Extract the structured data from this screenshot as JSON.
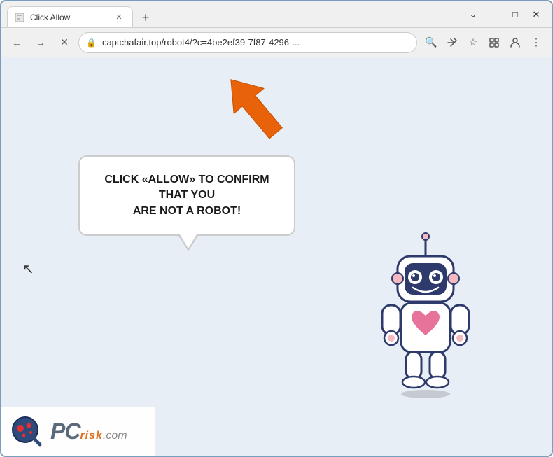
{
  "window": {
    "title": "Click Allow",
    "controls": {
      "minimize": "—",
      "maximize": "□",
      "close": "✕",
      "expand": "⌄"
    }
  },
  "tab": {
    "title": "Click Allow",
    "close_label": "✕",
    "new_tab_label": "+"
  },
  "nav": {
    "back_label": "←",
    "forward_label": "→",
    "refresh_label": "✕",
    "address": "captchafair.top/robot4/?c=4be2ef39-7f87-4296-...",
    "lock_symbol": "🔒",
    "search_label": "🔍",
    "share_label": "↗",
    "bookmark_label": "☆",
    "extension_label": "⊡",
    "profile_label": "👤",
    "menu_label": "⋮"
  },
  "page": {
    "bubble_line1": "CLICK «ALLOW» TO CONFIRM THAT YOU",
    "bubble_line2": "ARE NOT A ROBOT!"
  },
  "pcrisk": {
    "pc_text": "PC",
    "risk_text": "risk",
    "com_text": ".com"
  },
  "colors": {
    "arrow_orange": "#e8620a",
    "background": "#e8eef5",
    "bubble_border": "#cccccc",
    "robot_body": "#ffffff",
    "robot_outline": "#2d3a6b",
    "robot_pink": "#f4b8c0",
    "robot_heart": "#e8739a"
  }
}
